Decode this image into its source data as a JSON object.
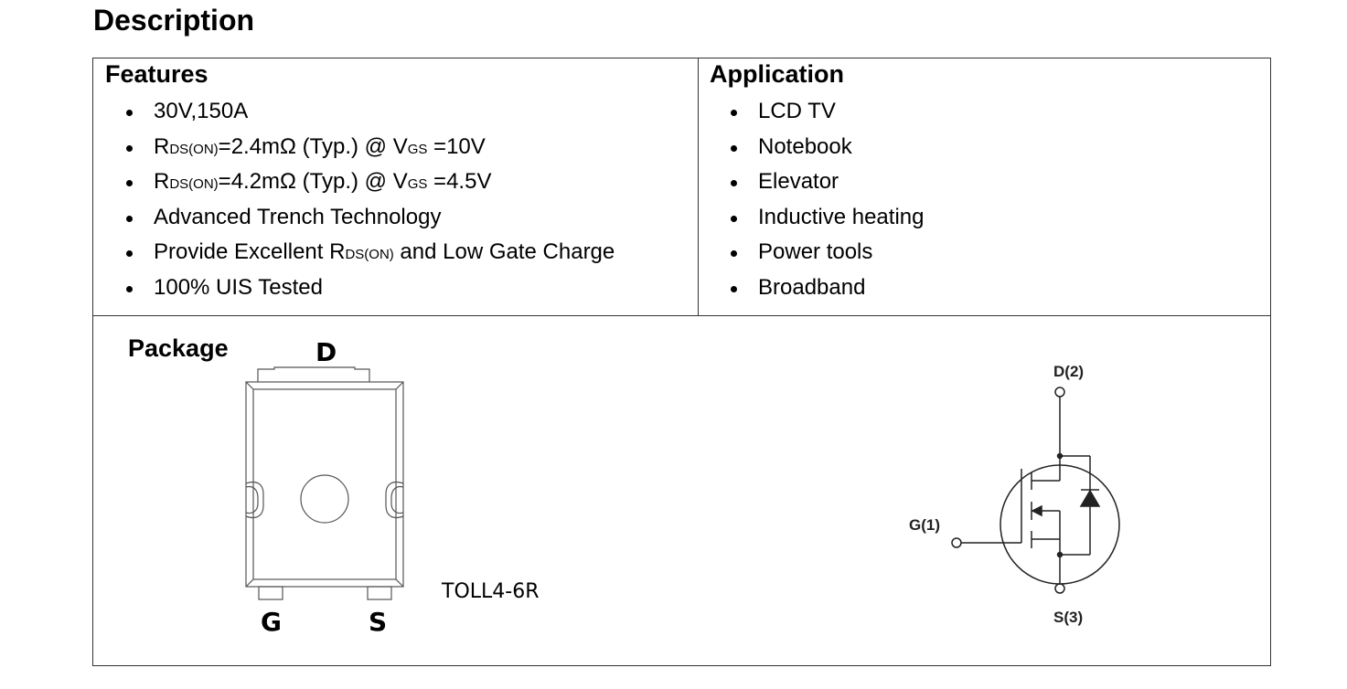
{
  "section_title": "Description",
  "features": {
    "title": "Features",
    "items": [
      {
        "text": "30V,150A"
      },
      {
        "pre": "R",
        "sub": "DS(ON)",
        "mid": "=2.4mΩ (Typ.) @ V",
        "sub2": "GS",
        "post": " =10V"
      },
      {
        "pre": "R",
        "sub": "DS(ON)",
        "mid": "=4.2mΩ (Typ.) @ V",
        "sub2": "GS",
        "post": " =4.5V"
      },
      {
        "text": "Advanced Trench Technology"
      },
      {
        "pre": "Provide Excellent R",
        "sub": "DS(ON)",
        "post": " and Low Gate Charge"
      },
      {
        "text": "100% UIS Tested"
      }
    ]
  },
  "application": {
    "title": "Application",
    "items": [
      "LCD TV",
      "Notebook",
      "Elevator",
      "Inductive heating",
      "Power tools",
      "Broadband"
    ]
  },
  "package": {
    "title": "Package",
    "pin_top": "D",
    "pin_left": "G",
    "pin_right": "S",
    "name": "TOLL4-6R"
  },
  "schematic": {
    "drain_label": "D(2)",
    "gate_label": "G(1)",
    "source_label": "S(3)"
  }
}
